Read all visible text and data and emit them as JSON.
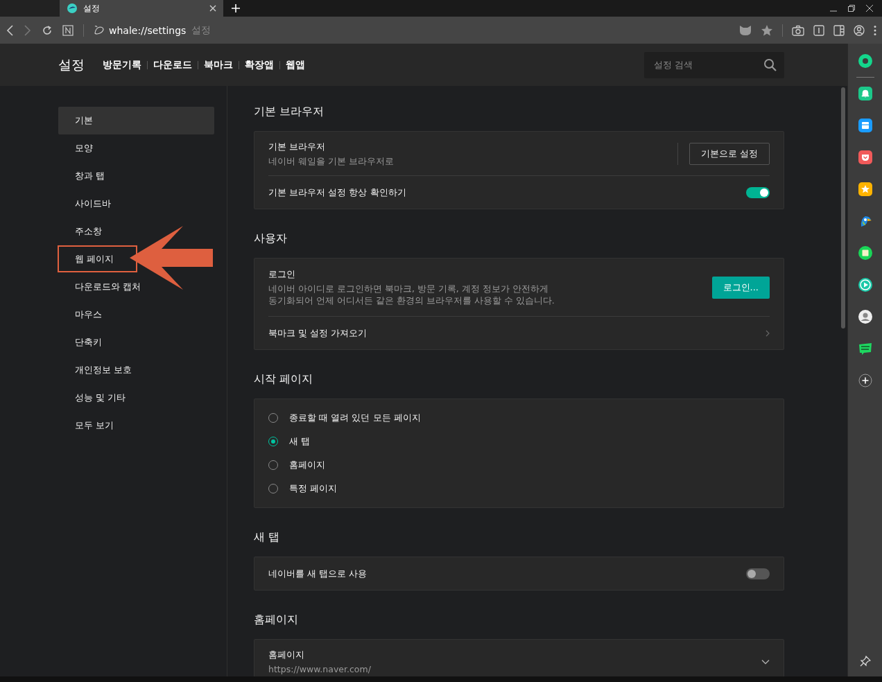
{
  "tabs": [
    {
      "title": "설정",
      "selected": true
    }
  ],
  "address_bar": {
    "url": "whale://settings",
    "page_title": "설정"
  },
  "header": {
    "title": "설정",
    "links": [
      "방문기록",
      "다운로드",
      "북마크",
      "확장앱",
      "웹앱"
    ],
    "search": {
      "placeholder": "설정 검색"
    }
  },
  "nav": {
    "items": [
      {
        "label": "기본",
        "selected": true,
        "highlighted": false
      },
      {
        "label": "모양",
        "selected": false,
        "highlighted": false
      },
      {
        "label": "창과 탭",
        "selected": false,
        "highlighted": false
      },
      {
        "label": "사이드바",
        "selected": false,
        "highlighted": false
      },
      {
        "label": "주소창",
        "selected": false,
        "highlighted": false
      },
      {
        "label": "웹 페이지",
        "selected": false,
        "highlighted": true
      },
      {
        "label": "다운로드와 캡처",
        "selected": false,
        "highlighted": false
      },
      {
        "label": "마우스",
        "selected": false,
        "highlighted": false
      },
      {
        "label": "단축키",
        "selected": false,
        "highlighted": false
      },
      {
        "label": "개인정보 보호",
        "selected": false,
        "highlighted": false
      },
      {
        "label": "성능 및 기타",
        "selected": false,
        "highlighted": false
      },
      {
        "label": "모두 보기",
        "selected": false,
        "highlighted": false
      }
    ]
  },
  "sections": [
    {
      "title": "기본 브라우저",
      "rows": [
        {
          "kind": "button",
          "label": "기본 브라우저",
          "description": [
            "네이버 웨일을 기본 브라우저로"
          ],
          "button": "기본으로 설정"
        },
        {
          "kind": "toggle",
          "label": "기본 브라우저 설정 항상 확인하기",
          "on": true
        }
      ]
    },
    {
      "title": "사용자",
      "rows": [
        {
          "kind": "primary_button",
          "label": "로그인",
          "description": [
            "네이버 아이디로 로그인하면 북마크, 방문 기록, 계정 정보가 안전하게",
            "동기화되어 언제 어디서든 같은 환경의 브라우저를 사용할 수 있습니다."
          ],
          "button": "로그인..."
        },
        {
          "kind": "link",
          "label": "북마크 및 설정 가져오기"
        }
      ]
    },
    {
      "title": "시작 페이지",
      "rows": [
        {
          "kind": "radio_group",
          "options": [
            {
              "label": "종료할 때 열려 있던 모든 페이지",
              "selected": false
            },
            {
              "label": "새 탭",
              "selected": true
            },
            {
              "label": "홈페이지",
              "selected": false
            },
            {
              "label": "특정 페이지",
              "selected": false
            }
          ]
        }
      ]
    },
    {
      "title": "새 탭",
      "rows": [
        {
          "kind": "toggle",
          "label": "네이버를 새 탭으로 사용",
          "on": false
        }
      ]
    },
    {
      "title": "홈페이지",
      "rows": [
        {
          "kind": "dropdown",
          "label": "홈페이지",
          "description": [
            "https://www.naver.com/"
          ]
        }
      ]
    }
  ]
}
